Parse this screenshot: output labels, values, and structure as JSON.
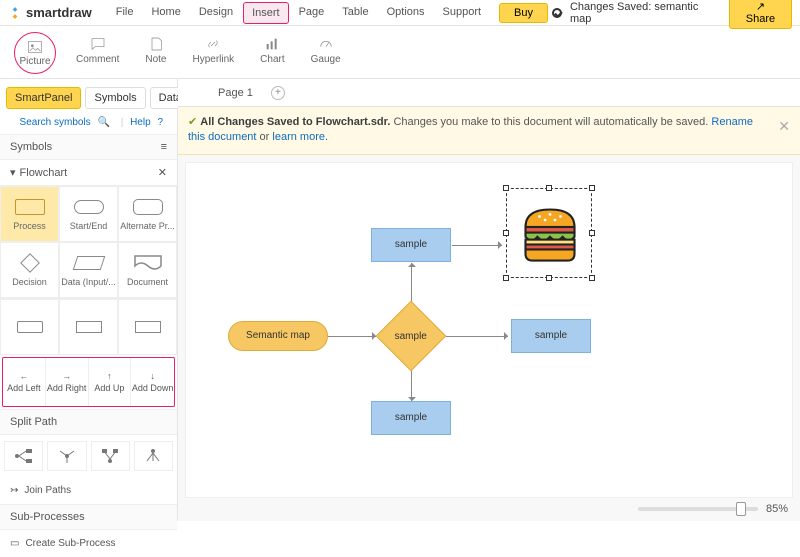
{
  "app": {
    "name": "smartdraw"
  },
  "menu": [
    "File",
    "Home",
    "Design",
    "Insert",
    "Page",
    "Table",
    "Options",
    "Support"
  ],
  "menu_highlight_index": 3,
  "buy_label": "Buy",
  "status": {
    "prefix": "Changes Saved:",
    "docname": "semantic map"
  },
  "share_label": "Share",
  "ribbon": [
    {
      "id": "picture",
      "label": "Picture"
    },
    {
      "id": "comment",
      "label": "Comment"
    },
    {
      "id": "note",
      "label": "Note"
    },
    {
      "id": "hyperlink",
      "label": "Hyperlink"
    },
    {
      "id": "chart",
      "label": "Chart"
    },
    {
      "id": "gauge",
      "label": "Gauge"
    }
  ],
  "ribbon_highlight_index": 0,
  "panel": {
    "tabs": [
      "SmartPanel",
      "Symbols",
      "Data"
    ],
    "active_tab": 0,
    "search_label": "Search symbols",
    "help_label": "Help",
    "symbols_header": "Symbols",
    "category": "Flowchart",
    "shapes": [
      {
        "id": "process",
        "label": "Process"
      },
      {
        "id": "startend",
        "label": "Start/End"
      },
      {
        "id": "altproc",
        "label": "Alternate Pr..."
      },
      {
        "id": "decision",
        "label": "Decision"
      },
      {
        "id": "datainput",
        "label": "Data (Input/..."
      },
      {
        "id": "document",
        "label": "Document"
      }
    ],
    "active_shape_index": 0,
    "add": [
      "Add Left",
      "Add Right",
      "Add Up",
      "Add Down"
    ],
    "split_header": "Split Path",
    "joinpaths": "Join Paths",
    "subproc_header": "Sub-Processes",
    "create_sub": "Create Sub-Process"
  },
  "page_tab": "Page 1",
  "notice": {
    "bold": "All Changes Saved to Flowchart.sdr.",
    "text1": " Changes you make to this document will automatically be saved. ",
    "link1": "Rename this document",
    "text2": " or ",
    "link2": "learn more",
    "text3": "."
  },
  "nodes": {
    "start": "Semantic map",
    "top": "sample",
    "center": "sample",
    "right": "sample",
    "bottom": "sample"
  },
  "zoom": "85%"
}
